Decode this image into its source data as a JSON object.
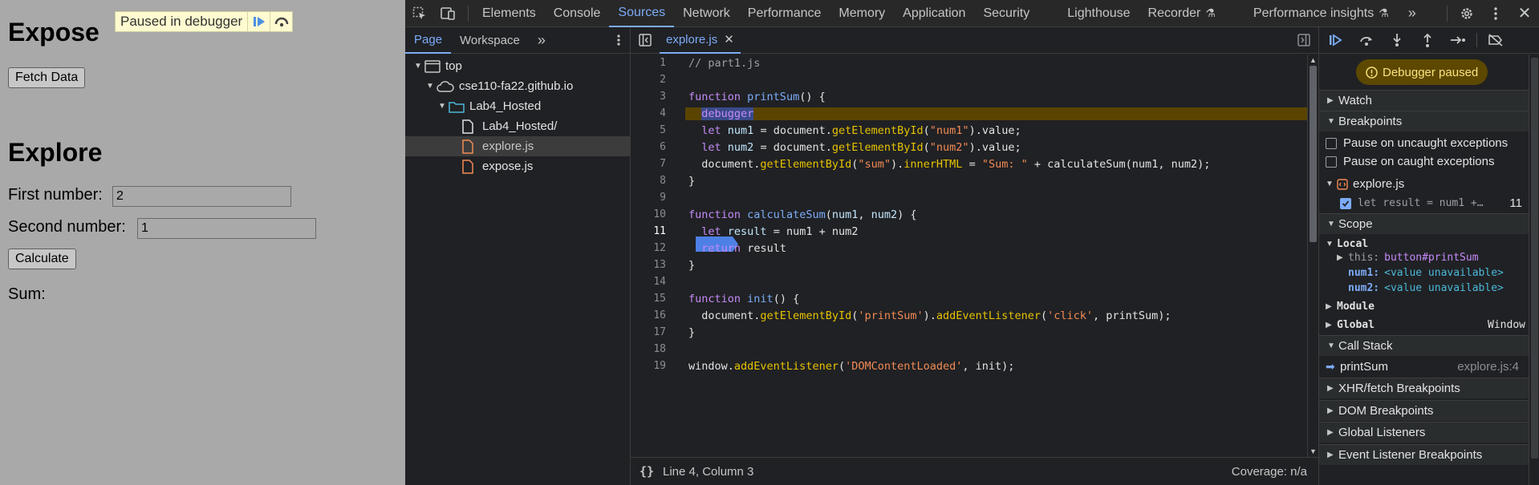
{
  "page": {
    "expose_heading": "Expose",
    "fetch_button": "Fetch Data",
    "explore_heading": "Explore",
    "first_label": "First number:",
    "first_value": "2",
    "second_label": "Second number:",
    "second_value": "1",
    "calculate_button": "Calculate",
    "sum_label": "Sum:",
    "paused_overlay": "Paused in debugger"
  },
  "toolbar": {
    "tabs": [
      "Elements",
      "Console",
      "Sources",
      "Network",
      "Performance",
      "Memory",
      "Application",
      "Security",
      "Lighthouse",
      "Recorder",
      "Performance insights"
    ],
    "active_tab": "Sources"
  },
  "navigator": {
    "tabs": [
      "Page",
      "Workspace"
    ],
    "tree": [
      {
        "label": "top"
      },
      {
        "label": "cse110-fa22.github.io"
      },
      {
        "label": "Lab4_Hosted"
      },
      {
        "label": "Lab4_Hosted/"
      },
      {
        "label": "explore.js"
      },
      {
        "label": "expose.js"
      }
    ]
  },
  "editor": {
    "tab_label": "explore.js",
    "status_position": "Line 4, Column 3",
    "coverage": "Coverage: n/a",
    "paused_line": 4,
    "breakpoint_line": 11
  },
  "sidebar": {
    "paused_label": "Debugger paused",
    "watch": "Watch",
    "breakpoints": "Breakpoints",
    "pause_uncaught": "Pause on uncaught exceptions",
    "pause_caught": "Pause on caught exceptions",
    "bp_file": "explore.js",
    "bp_code": "let result = num1 +…",
    "bp_line": "11",
    "scope": "Scope",
    "local": "Local",
    "this_key": "this:",
    "this_val": "button#printSum",
    "num1_key": "num1:",
    "num1_val": "<value unavailable>",
    "num2_key": "num2:",
    "num2_val": "<value unavailable>",
    "module": "Module",
    "global": "Global",
    "global_val": "Window",
    "call_stack": "Call Stack",
    "frame_name": "printSum",
    "frame_loc": "explore.js:4",
    "xhr": "XHR/fetch Breakpoints",
    "dom": "DOM Breakpoints",
    "global_listeners": "Global Listeners",
    "event_listeners": "Event Listener Breakpoints"
  },
  "colors": {
    "accent": "#7cacf8",
    "paused_highlight": "#5b4400",
    "keyword": "#c58af9",
    "function_call": "#e6c300",
    "string": "#f28b54"
  }
}
